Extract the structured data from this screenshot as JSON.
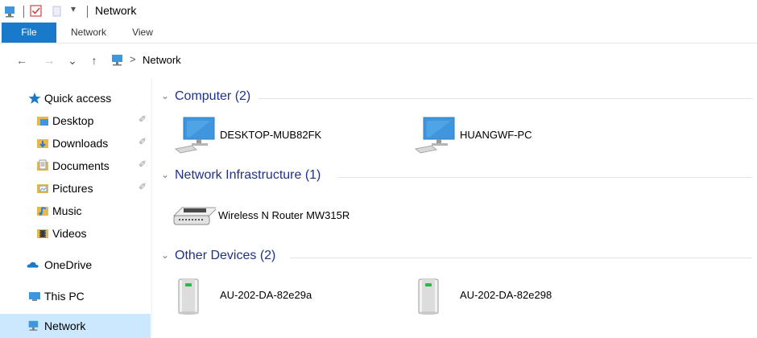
{
  "titlebar": {
    "title": "Network",
    "icons": [
      "network-icon",
      "properties-check-icon",
      "new-folder-icon",
      "customize-toolbar-icon"
    ]
  },
  "ribbon": {
    "tabs": [
      {
        "label": "File",
        "active": true
      },
      {
        "label": "Network",
        "active": false
      },
      {
        "label": "View",
        "active": false
      }
    ]
  },
  "navbar": {
    "back": "←",
    "forward": "→",
    "recent": "⌄",
    "up": "↑",
    "address": {
      "separator": ">",
      "text": "Network"
    }
  },
  "sidebar": {
    "items": [
      {
        "label": "Quick access",
        "icon": "star-icon"
      },
      {
        "label": "Desktop",
        "icon": "desktop-folder-icon",
        "pinned": true
      },
      {
        "label": "Downloads",
        "icon": "downloads-folder-icon",
        "pinned": true
      },
      {
        "label": "Documents",
        "icon": "documents-folder-icon",
        "pinned": true
      },
      {
        "label": "Pictures",
        "icon": "pictures-folder-icon",
        "pinned": true
      },
      {
        "label": "Music",
        "icon": "music-folder-icon"
      },
      {
        "label": "Videos",
        "icon": "videos-folder-icon"
      },
      {
        "label": "OneDrive",
        "icon": "onedrive-cloud-icon"
      },
      {
        "label": "This PC",
        "icon": "this-pc-icon"
      },
      {
        "label": "Network",
        "icon": "network-icon",
        "selected": true
      }
    ],
    "pin_glyph": "✐"
  },
  "content": {
    "groups": [
      {
        "label": "Computer (2)",
        "items": [
          {
            "label": "DESKTOP-MUB82FK",
            "icon": "computer-icon"
          },
          {
            "label": "HUANGWF-PC",
            "icon": "computer-icon"
          }
        ]
      },
      {
        "label": "Network Infrastructure (1)",
        "items": [
          {
            "label": "Wireless N Router MW315R",
            "icon": "router-icon"
          }
        ]
      },
      {
        "label": "Other Devices (2)",
        "items": [
          {
            "label": "AU-202-DA-82e29a",
            "icon": "device-tower-icon"
          },
          {
            "label": "AU-202-DA-82e298",
            "icon": "device-tower-icon"
          }
        ]
      }
    ],
    "chevron": "⌄"
  },
  "colors": {
    "file_tab": "#1979ca",
    "selected_bg": "#cce8ff",
    "group_header": "#1e3287",
    "monitor_blue": "#3d96de"
  }
}
